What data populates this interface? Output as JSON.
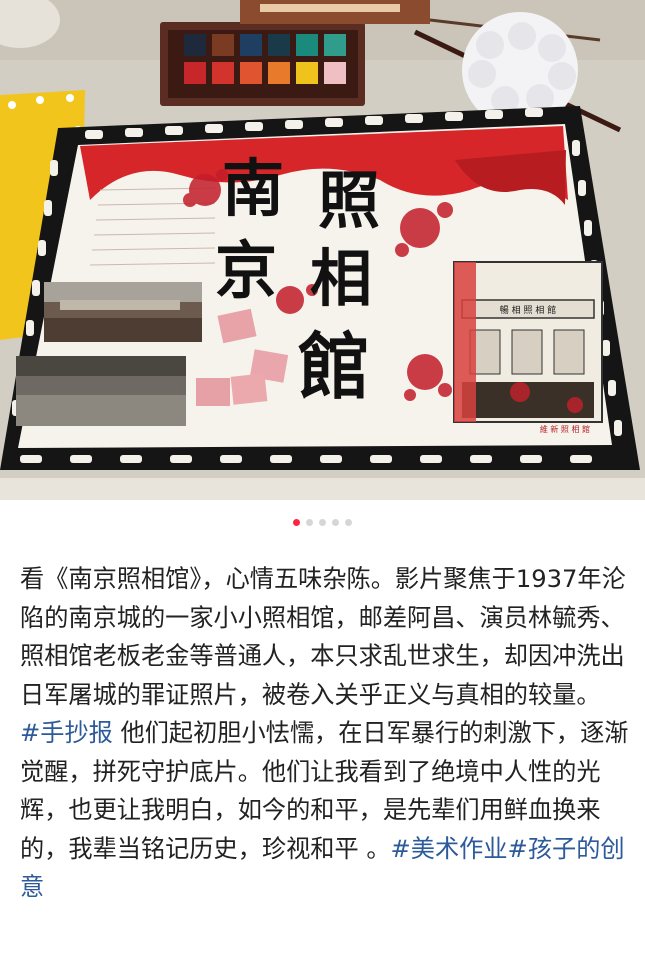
{
  "poster": {
    "title_chars": [
      "南",
      "京",
      "照",
      "相",
      "館"
    ],
    "signage_text": "暢 相 照 相 館",
    "signature": "維 新 照 相 館"
  },
  "carousel": {
    "total": 5,
    "active_index": 0
  },
  "post": {
    "paragraph1": "看《南京照相馆》，心情五味杂陈。影片聚焦于1937年沦陷的南京城的一家小小照相馆，邮差阿昌、演员林毓秀、照相馆老板老金等普通人，本只求乱世求生，却因冲洗出日军屠城的罪证照片，被卷入关乎正义与真相的较量。",
    "tag1": "#手抄报",
    "paragraph2": " 他们起初胆小怯懦，在日军暴行的刺激下，逐渐觉醒，拼死守护底片。他们让我看到了绝境中人性的光辉，也更让我明白，如今的和平，是先辈们用鲜血换来的，我辈当铭记历史，珍视和平 。",
    "tag2": "#美术作业",
    "tag3": "#孩子的创意"
  },
  "colors": {
    "accent": "#ff2442",
    "tag": "#2d5a9a",
    "poster_red": "#d7262a",
    "film_black": "#151515"
  }
}
